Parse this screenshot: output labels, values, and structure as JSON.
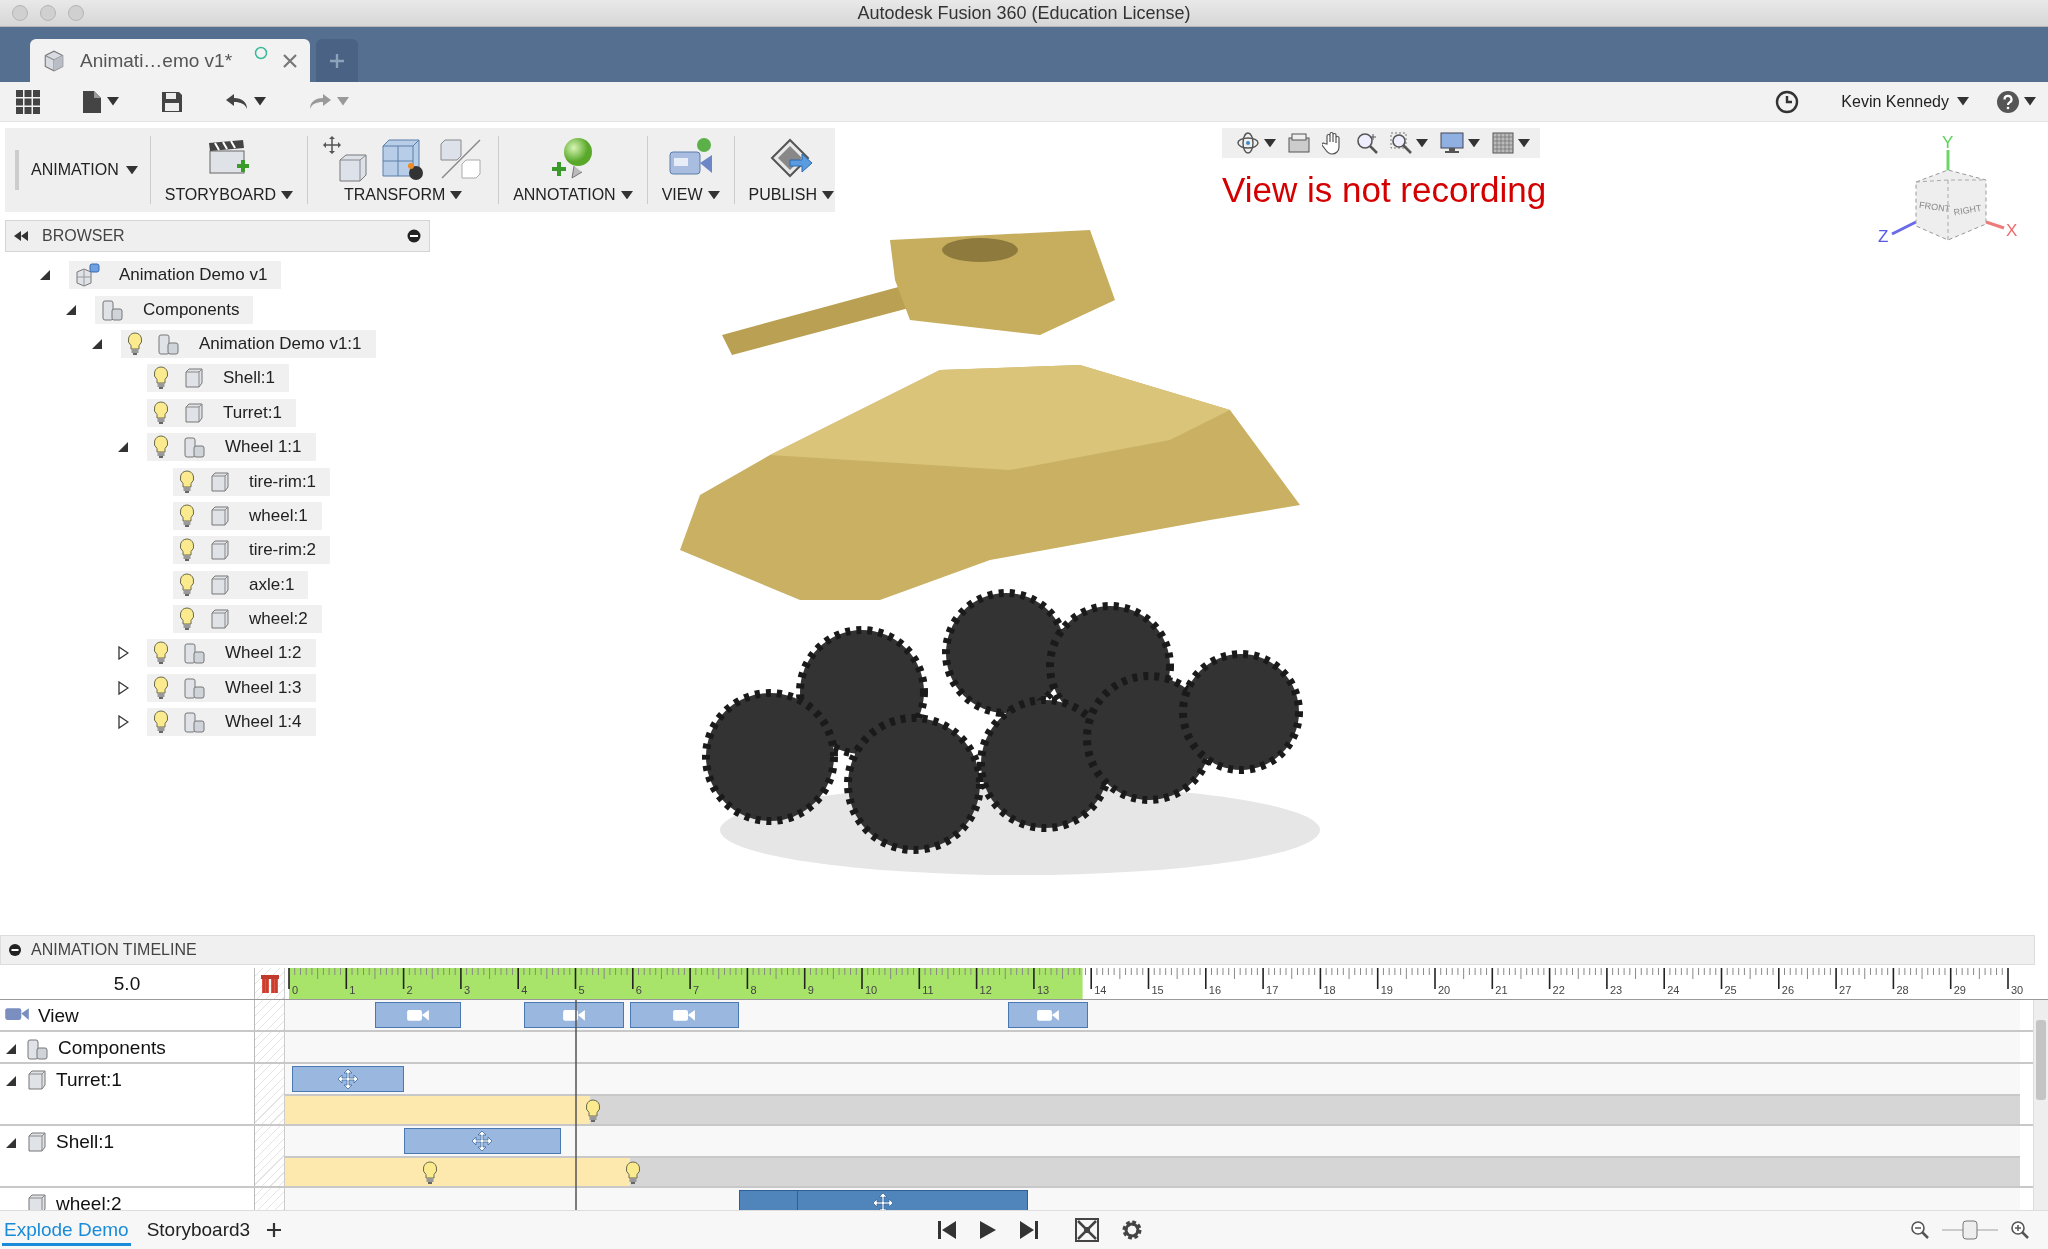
{
  "window": {
    "title": "Autodesk Fusion 360 (Education License)"
  },
  "document_tabs": [
    {
      "label": "Animati…emo v1*",
      "selected": true
    }
  ],
  "toolbar": {
    "user": "Kevin Kennedy"
  },
  "ribbon": {
    "workspace": "ANIMATION",
    "groups": [
      {
        "label": "STORYBOARD",
        "tools": [
          {
            "kind": "clapper"
          }
        ]
      },
      {
        "label": "TRANSFORM",
        "tools": [
          {
            "kind": "move"
          },
          {
            "kind": "explode"
          },
          {
            "kind": "restore"
          }
        ]
      },
      {
        "label": "ANNOTATION",
        "tools": [
          {
            "kind": "callout"
          }
        ]
      },
      {
        "label": "VIEW",
        "tools": [
          {
            "kind": "camera"
          }
        ]
      },
      {
        "label": "PUBLISH",
        "tools": [
          {
            "kind": "film"
          }
        ]
      }
    ]
  },
  "browser": {
    "title": "BROWSER",
    "tree": [
      {
        "label": "Animation Demo v1",
        "kind": "design",
        "expanded": true,
        "children": [
          {
            "label": "Components",
            "kind": "folder",
            "expanded": true,
            "children": [
              {
                "label": "Animation Demo v1:1",
                "kind": "component",
                "expanded": true,
                "visible": true,
                "children": [
                  {
                    "label": "Shell:1",
                    "kind": "body",
                    "visible": true
                  },
                  {
                    "label": "Turret:1",
                    "kind": "body",
                    "visible": true
                  },
                  {
                    "label": "Wheel 1:1",
                    "kind": "component",
                    "expanded": true,
                    "visible": true,
                    "children": [
                      {
                        "label": "tire-rim:1",
                        "kind": "body",
                        "visible": true
                      },
                      {
                        "label": "wheel:1",
                        "kind": "body",
                        "visible": true
                      },
                      {
                        "label": "tire-rim:2",
                        "kind": "body",
                        "visible": true
                      },
                      {
                        "label": "axle:1",
                        "kind": "body",
                        "visible": true
                      },
                      {
                        "label": "wheel:2",
                        "kind": "body",
                        "visible": true
                      }
                    ]
                  },
                  {
                    "label": "Wheel 1:2",
                    "kind": "component",
                    "expanded": false,
                    "visible": true
                  },
                  {
                    "label": "Wheel 1:3",
                    "kind": "component",
                    "expanded": false,
                    "visible": true
                  },
                  {
                    "label": "Wheel 1:4",
                    "kind": "component",
                    "expanded": false,
                    "visible": true
                  }
                ]
              }
            ]
          }
        ]
      }
    ]
  },
  "viewport": {
    "status": "View is not recording",
    "viewcube": {
      "faces": [
        "FRONT",
        "RIGHT"
      ],
      "axes": [
        "Y",
        "Z",
        "X"
      ]
    }
  },
  "timeline": {
    "title": "ANIMATION TIMELINE",
    "time": "5.0",
    "ruler": [
      "0",
      "1",
      "2",
      "3",
      "4",
      "5",
      "6",
      "7",
      "8",
      "9",
      "10",
      "11",
      "12",
      "13",
      "14",
      "15",
      "16",
      "17",
      "18",
      "19",
      "20",
      "21",
      "22",
      "23",
      "24",
      "25",
      "26",
      "27",
      "28",
      "29",
      "30"
    ],
    "tracks": [
      {
        "label": "View",
        "kind": "view",
        "actions": [
          {
            "kind": "camera"
          },
          {
            "kind": "camera"
          },
          {
            "kind": "camera"
          },
          {
            "kind": "camera"
          }
        ]
      },
      {
        "label": "Components",
        "kind": "folder",
        "expanded": true
      },
      {
        "label": "Turret:1",
        "kind": "body",
        "expanded": true,
        "actions": [
          {
            "kind": "move"
          }
        ],
        "visibility": [
          {
            "kind": "bulb"
          }
        ]
      },
      {
        "label": "Shell:1",
        "kind": "body",
        "expanded": true,
        "actions": [
          {
            "kind": "move"
          }
        ],
        "visibility": [
          {
            "kind": "bulb"
          },
          {
            "kind": "bulb"
          }
        ]
      },
      {
        "label": "wheel:2",
        "kind": "body",
        "actions": [
          {
            "kind": "move-selected"
          }
        ]
      }
    ],
    "zoom": {
      "level": 0.5
    },
    "storyboards": [
      {
        "label": "Explode Demo",
        "selected": true
      },
      {
        "label": "Storyboard3",
        "selected": false
      }
    ]
  }
}
